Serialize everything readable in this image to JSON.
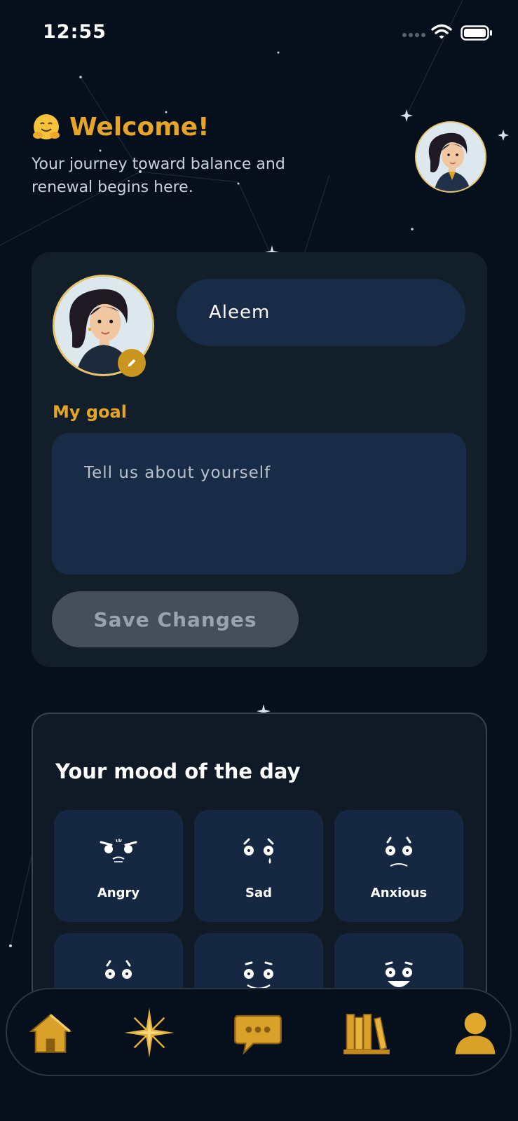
{
  "status_bar": {
    "time": "12:55"
  },
  "header": {
    "title": "Welcome!",
    "subtitle": "Your journey toward balance and renewal begins here."
  },
  "profile": {
    "name_value": "Aleem",
    "goal_label": "My goal",
    "goal_placeholder": "Tell us about yourself",
    "save_label": "Save Changes"
  },
  "mood": {
    "title": "Your mood of the day",
    "items": [
      {
        "label": "Angry"
      },
      {
        "label": "Sad"
      },
      {
        "label": "Anxious"
      },
      {
        "label": ""
      },
      {
        "label": ""
      },
      {
        "label": ""
      }
    ]
  },
  "nav": {
    "items": [
      {
        "icon": "home-icon"
      },
      {
        "icon": "star-icon"
      },
      {
        "icon": "chat-icon"
      },
      {
        "icon": "books-icon"
      },
      {
        "icon": "profile-icon"
      }
    ]
  },
  "colors": {
    "accent": "#e6a526",
    "background": "#06101c",
    "card": "#131e2b",
    "field": "#182b47"
  }
}
